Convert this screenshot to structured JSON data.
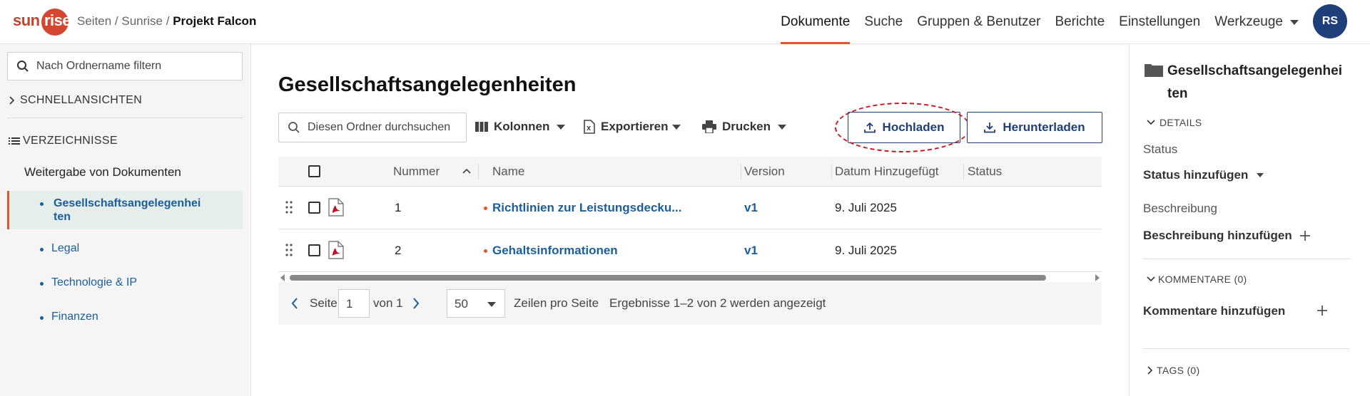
{
  "header": {
    "logo": "sunrise",
    "breadcrumb": {
      "prefix": "Seiten / Sunrise / ",
      "current": "Projekt Falcon"
    },
    "nav": [
      "Dokumente",
      "Suche",
      "Gruppen & Benutzer",
      "Berichte",
      "Einstellungen",
      "Werkzeuge"
    ],
    "avatar_initials": "RS",
    "accent_color": "#e0572a"
  },
  "sidebar": {
    "filter_placeholder": "Nach Ordnername filtern",
    "quick_views": "SCHNELLANSICHTEN",
    "directories": "VERZEICHNISSE",
    "sub_heading": "Weitergabe von Dokumenten",
    "items": [
      {
        "label_line1": "Gesellschaftsangelegenhei",
        "label_line2": "ten"
      },
      {
        "label": "Legal"
      },
      {
        "label": "Technologie & IP"
      },
      {
        "label": "Finanzen"
      }
    ]
  },
  "main": {
    "title": "Gesellschaftsangelegenheiten",
    "search_placeholder": "Diesen Ordner durchsuchen",
    "toolbar": {
      "columns": "Kolonnen",
      "export": "Exportieren",
      "print": "Drucken",
      "upload": "Hochladen",
      "download": "Herunterladen"
    },
    "table": {
      "headers": [
        "Nummer",
        "Name",
        "Version",
        "Datum Hinzugefügt",
        "Status"
      ],
      "rows": [
        {
          "number": "1",
          "name": "Richtlinien zur Leistungsdecku...",
          "version": "v1",
          "date": "9. Juli 2025",
          "status": ""
        },
        {
          "number": "2",
          "name": "Gehaltsinformationen",
          "version": "v1",
          "date": "9. Juli 2025",
          "status": ""
        }
      ]
    },
    "pager": {
      "page_label": "Seite",
      "page": "1",
      "of_label": "von 1",
      "per_page": "50",
      "per_page_label": "Zeilen pro Seite",
      "results": "Ergebnisse 1–2 von 2 werden angezeigt"
    }
  },
  "right_panel": {
    "title_line1": "Gesellschaftsangelegenhei",
    "title_line2": "ten",
    "details": "DETAILS",
    "status_label": "Status",
    "status_add": "Status hinzufügen",
    "description_label": "Beschreibung",
    "description_add": "Beschreibung hinzufügen",
    "comments": "KOMMENTARE (0)",
    "comments_add": "Kommentare hinzufügen",
    "tags": "TAGS (0)"
  }
}
